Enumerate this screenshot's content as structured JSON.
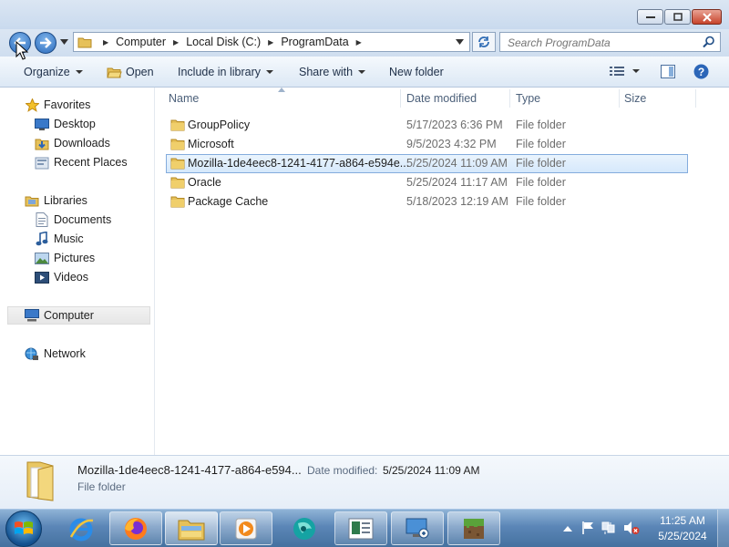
{
  "window": {
    "controls": {
      "minimize": "minimize-icon",
      "maximize": "maximize-icon",
      "close": "close-icon"
    }
  },
  "address": {
    "breadcrumbs": [
      "Computer",
      "Local Disk (C:)",
      "ProgramData"
    ]
  },
  "search": {
    "placeholder": "Search ProgramData"
  },
  "toolbar": {
    "organize": "Organize",
    "open": "Open",
    "include_in_library": "Include in library",
    "share_with": "Share with",
    "new_folder": "New folder"
  },
  "nav": {
    "favorites": {
      "label": "Favorites",
      "items": [
        "Desktop",
        "Downloads",
        "Recent Places"
      ]
    },
    "libraries": {
      "label": "Libraries",
      "items": [
        "Documents",
        "Music",
        "Pictures",
        "Videos"
      ]
    },
    "computer": "Computer",
    "network": "Network"
  },
  "columns": {
    "name": "Name",
    "date": "Date modified",
    "type": "Type",
    "size": "Size"
  },
  "files": [
    {
      "name": "GroupPolicy",
      "date": "5/17/2023 6:36 PM",
      "type": "File folder"
    },
    {
      "name": "Microsoft",
      "date": "9/5/2023 4:32 PM",
      "type": "File folder"
    },
    {
      "name": "Mozilla-1de4eec8-1241-4177-a864-e594e...",
      "date": "5/25/2024 11:09 AM",
      "type": "File folder",
      "selected": true
    },
    {
      "name": "Oracle",
      "date": "5/25/2024 11:17 AM",
      "type": "File folder"
    },
    {
      "name": "Package Cache",
      "date": "5/18/2023 12:19 AM",
      "type": "File folder"
    }
  ],
  "details": {
    "name": "Mozilla-1de4eec8-1241-4177-a864-e594...",
    "date_label": "Date modified:",
    "date": "5/25/2024 11:09 AM",
    "type": "File folder"
  },
  "taskbar": {
    "apps": [
      "internet-explorer",
      "firefox",
      "windows-explorer",
      "media-player",
      "app-teal-icon",
      "presentation-app",
      "remote-desktop",
      "minecraft"
    ],
    "clock": {
      "time": "11:25 AM",
      "date": "5/25/2024"
    }
  },
  "colors": {
    "accent": "#2a6bbd",
    "selection": "#d5e8fb",
    "taskbar": "#45719f"
  }
}
